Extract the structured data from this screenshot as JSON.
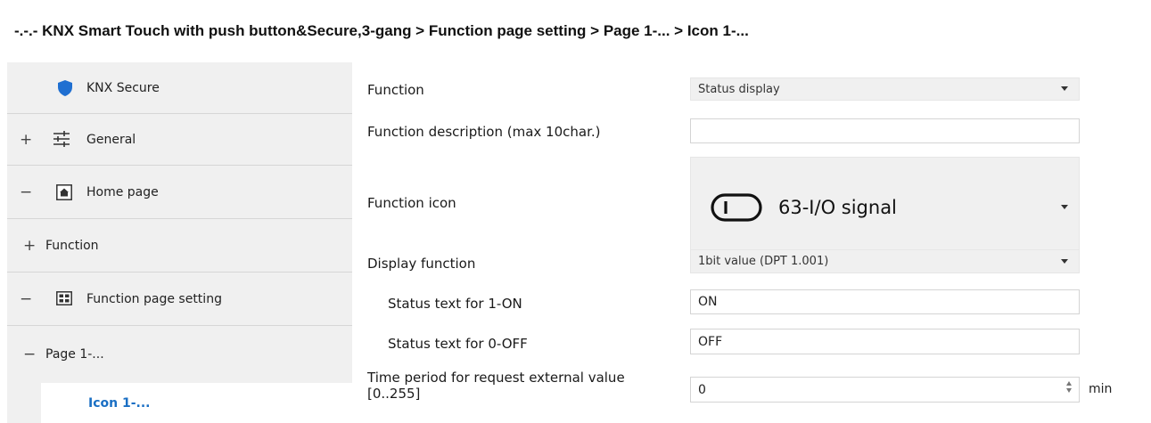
{
  "breadcrumb": "-.-.- KNX Smart Touch with push button&Secure,3-gang > Function page setting > Page 1-... > Icon 1-...",
  "sidebar": {
    "items": [
      {
        "label": "KNX Secure",
        "toggle": "",
        "icon": "shield-icon"
      },
      {
        "label": "General",
        "toggle": "+",
        "icon": "sliders-icon"
      },
      {
        "label": "Home page",
        "toggle": "−",
        "icon": "home-icon"
      },
      {
        "label": "Function",
        "toggle": "+",
        "icon": ""
      },
      {
        "label": "Function page setting",
        "toggle": "−",
        "icon": "grid-icon"
      },
      {
        "label": "Page 1-...",
        "toggle": "−",
        "icon": ""
      },
      {
        "label": "Icon 1-...",
        "toggle": "",
        "icon": "",
        "selected": true
      }
    ]
  },
  "params": {
    "function": {
      "label": "Function",
      "value": "Status display"
    },
    "description": {
      "label": "Function description (max 10char.)",
      "value": ""
    },
    "icon": {
      "label": "Function icon",
      "value": "63-I/O signal",
      "icon": "io-signal-toggle-icon"
    },
    "display": {
      "label": "Display function",
      "value": "1bit value (DPT 1.001)"
    },
    "status_on": {
      "label": "Status text for 1-ON",
      "value": "ON"
    },
    "status_off": {
      "label": "Status text for 0-OFF",
      "value": "OFF"
    },
    "period": {
      "label_line1": "Time period for request external value",
      "label_line2": "[0..255]",
      "value": "0",
      "unit": "min"
    }
  },
  "colors": {
    "accent": "#1a6fc4",
    "shield": "#1f6fd1",
    "sidebar_bg": "#f0f0f0"
  }
}
